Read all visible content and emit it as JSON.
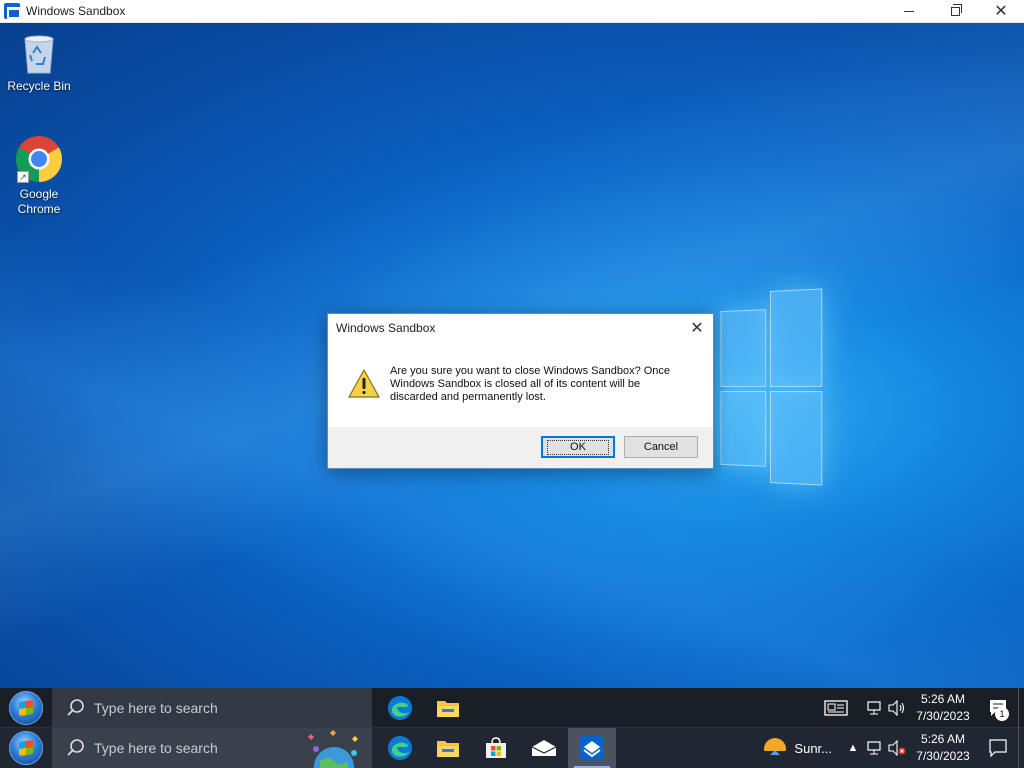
{
  "window": {
    "title": "Windows Sandbox"
  },
  "desktop": {
    "icons": [
      {
        "label": "Recycle Bin"
      },
      {
        "label": "Google Chrome"
      }
    ]
  },
  "dialog": {
    "title": "Windows Sandbox",
    "message": "Are you sure you want to close Windows Sandbox? Once Windows Sandbox is closed all of its content will be discarded and permanently lost.",
    "ok_label": "OK",
    "cancel_label": "Cancel"
  },
  "taskbar_inner": {
    "search_placeholder": "Type here to search",
    "time": "5:26 AM",
    "date": "7/30/2023",
    "notification_count": "1"
  },
  "taskbar_host": {
    "search_placeholder": "Type here to search",
    "weather_text": "Sunr...",
    "time": "5:26 AM",
    "date": "7/30/2023"
  },
  "colors": {
    "desktop_blue": "#0b67c8",
    "taskbar": "#1a1e26",
    "accent": "#0078d7"
  }
}
